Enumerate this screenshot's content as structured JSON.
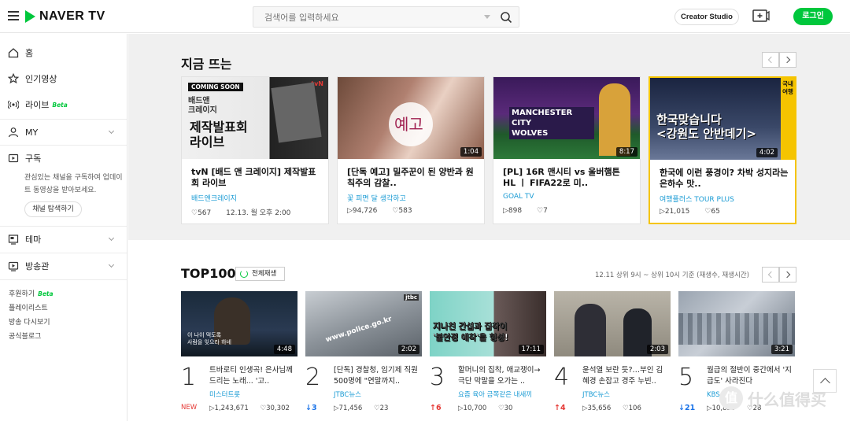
{
  "header": {
    "logo": "NAVER TV",
    "search_placeholder": "검색어를 입력하세요",
    "creator_studio": "Creator Studio",
    "login": "로그인"
  },
  "sidebar": {
    "home": "홈",
    "popular": "인기영상",
    "live": "라이브",
    "live_tag": "Beta",
    "my": "MY",
    "subscribe": "구독",
    "subscribe_desc": "관심있는 채널을 구독하여 업데이트 동영상을 받아보세요.",
    "explore_channels": "채널 탐색하기",
    "theme": "테마",
    "broadcast": "방송관",
    "sponsor": "후원하기",
    "sponsor_tag": "Beta",
    "playlist": "플레이리스트",
    "rewatch": "방송 다시보기",
    "blog": "공식블로그"
  },
  "trending": {
    "title": "지금 뜨는",
    "cards": [
      {
        "title": "tvN [배드 앤 크레이지] 제작발표회 라이브",
        "channel": "배드앤크레이지",
        "likes": "567",
        "date": "12.13. 월 오후 2:00",
        "duration": "",
        "badge": "COMING SOON",
        "thumb_text": "제작발표회\n라이브",
        "thumb_sub": "배드앤\n크레이지",
        "network": "tvN"
      },
      {
        "title": "[단독 예고] 밀주꾼이 된 양반과 원칙주의 감찰..",
        "channel": "꽃 피면 달 생각하고",
        "views": "94,726",
        "likes": "583",
        "duration": "1:04",
        "thumb_text": "예고"
      },
      {
        "title": "[PL] 16R 맨시티 vs 울버햄튼 HL ㅣ FIFA22로 미..",
        "channel": "GOAL TV",
        "views": "898",
        "likes": "7",
        "duration": "8:17",
        "thumb_text": "MANCHESTER CITY\nWOLVES"
      },
      {
        "title": "한국에 이런 풍경이? 차박 성지라는 은하수 맛..",
        "channel": "여행플러스 TOUR PLUS",
        "views": "21,015",
        "likes": "65",
        "duration": "4:02",
        "thumb_text": "한국맞습니다\n<강원도 안반데기>",
        "thumb_side": "국내여행"
      }
    ]
  },
  "top100": {
    "title": "TOP100",
    "play_all": "전체재생",
    "basis": "12.11 상위 9시 ~ 상위 10시 기준 (재생수, 재생시간)",
    "items": [
      {
        "rank": "1",
        "title": "트바로티 인생곡! 은사님께 드리는 노래... '고..",
        "channel": "미스터트롯",
        "change": "NEW",
        "views": "1,243,671",
        "likes": "30,302",
        "duration": "4:48",
        "thumb_text": "이 나이 먹도록\n사람을 잊으라 하네"
      },
      {
        "rank": "2",
        "title": "[단독] 경찰청, 임기제 직원 500명에 \"연말까지..",
        "channel": "JTBC뉴스",
        "change": "↓3",
        "views": "71,456",
        "likes": "23",
        "duration": "2:02",
        "thumb_text": "www.police.go.kr"
      },
      {
        "rank": "3",
        "title": "할머니의 집착, 애교쟁이→극단 막말을 오가는 ..",
        "channel": "요즘 육아 금쪽같은 내새끼",
        "change": "↑6",
        "views": "10,700",
        "likes": "30",
        "duration": "17:11",
        "thumb_text": "지나친 간섭과 집착이\n'불안정 애착'을 형성!"
      },
      {
        "rank": "4",
        "title": "윤석열 보란 듯?…부인 김혜경 손잡고 경주 누빈..",
        "channel": "JTBC뉴스",
        "change": "↑4",
        "views": "35,656",
        "likes": "106",
        "duration": "2:03"
      },
      {
        "rank": "5",
        "title": "월급의 절반이 중간에서 '지급도' 사라진다",
        "channel": "KBS 뉴스",
        "change": "↓21",
        "views": "10,850",
        "likes": "28",
        "duration": "3:21"
      }
    ]
  },
  "watermark": "什么值得买",
  "colors": {
    "accent": "#00c73c",
    "link": "#1a9bd4",
    "up": "#e53935",
    "down": "#1a73e8"
  }
}
